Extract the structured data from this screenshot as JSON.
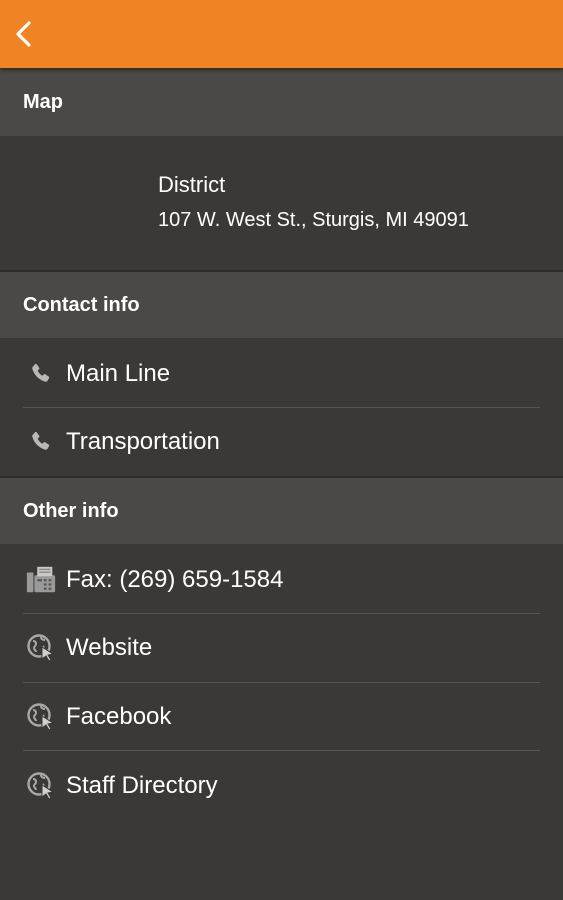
{
  "app": {
    "accent_color": "#f08424",
    "background_color": "#3a3937",
    "header_color": "#4a4947"
  },
  "topbar": {
    "back_icon": "chevron-left-icon"
  },
  "sections": {
    "map": {
      "title": "Map",
      "location_name": "District",
      "address": "107 W. West St., Sturgis, MI 49091"
    },
    "contact": {
      "title": "Contact info",
      "items": [
        {
          "label": "Main Line",
          "icon": "phone-icon"
        },
        {
          "label": "Transportation",
          "icon": "phone-icon"
        }
      ]
    },
    "other": {
      "title": "Other info",
      "items": [
        {
          "label": "Fax: (269) 659-1584",
          "icon": "fax-icon"
        },
        {
          "label": "Website",
          "icon": "globe-link-icon"
        },
        {
          "label": "Facebook",
          "icon": "globe-link-icon"
        },
        {
          "label": "Staff Directory",
          "icon": "globe-link-icon"
        }
      ]
    }
  }
}
